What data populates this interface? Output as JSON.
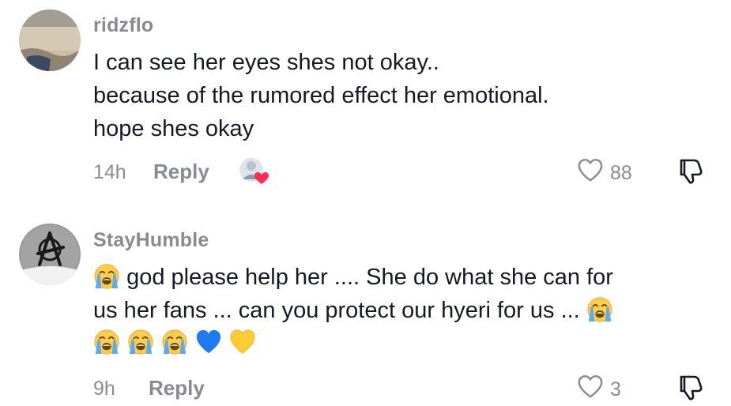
{
  "comments": [
    {
      "username": "ridzflo",
      "lines": [
        "I can see her eyes shes not okay..",
        "because of the rumored effect her emotional.",
        "hope shes okay"
      ],
      "time": "14h",
      "reply_label": "Reply",
      "like_count": "88",
      "creator_liked": true
    },
    {
      "username": "StayHumble",
      "line1_text": "god please help her .... She do what she can for",
      "line2_text": "us her fans ... can you protect our hyeri for us ...",
      "line3_emojis": [
        "loudly-crying-face",
        "loudly-crying-face",
        "loudly-crying-face",
        "blue-heart",
        "yellow-heart"
      ],
      "time": "9h",
      "reply_label": "Reply",
      "like_count": "3"
    }
  ],
  "colors": {
    "text": "#161823",
    "muted": "#8a8b91",
    "like_heart": "#fe2c55"
  }
}
